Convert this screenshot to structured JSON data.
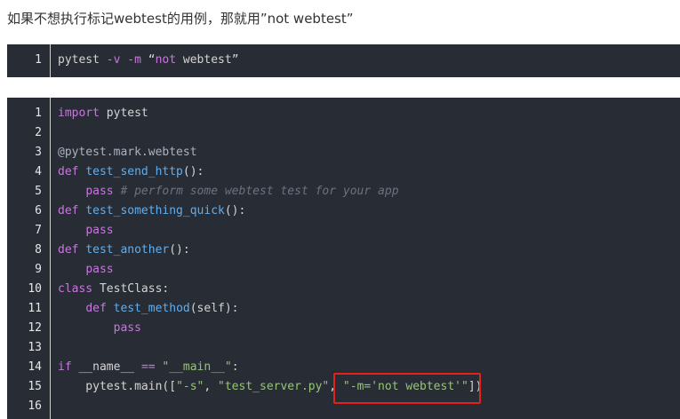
{
  "intro": "如果不想执行标记webtest的用例，那就用”not webtest”",
  "block1": {
    "lines": [
      {
        "n": "1",
        "tokens": [
          {
            "t": "pytest ",
            "c": "plain"
          },
          {
            "t": "-v",
            "c": "op"
          },
          {
            "t": " ",
            "c": "plain"
          },
          {
            "t": "-m",
            "c": "op"
          },
          {
            "t": " “",
            "c": "plain"
          },
          {
            "t": "not",
            "c": "kw"
          },
          {
            "t": " webtest”",
            "c": "plain"
          }
        ]
      }
    ]
  },
  "block2": {
    "lines": [
      {
        "n": "1",
        "tokens": [
          {
            "t": "import",
            "c": "kw"
          },
          {
            "t": " pytest",
            "c": "plain"
          }
        ]
      },
      {
        "n": "2",
        "tokens": []
      },
      {
        "n": "3",
        "tokens": [
          {
            "t": "@pytest.mark.webtest",
            "c": "dec"
          }
        ]
      },
      {
        "n": "4",
        "tokens": [
          {
            "t": "def",
            "c": "kw"
          },
          {
            "t": " ",
            "c": "plain"
          },
          {
            "t": "test_send_http",
            "c": "fn"
          },
          {
            "t": "():",
            "c": "plain"
          }
        ]
      },
      {
        "n": "5",
        "tokens": [
          {
            "t": "    ",
            "c": "plain"
          },
          {
            "t": "pass",
            "c": "kw"
          },
          {
            "t": " ",
            "c": "plain"
          },
          {
            "t": "# perform some webtest test for your app",
            "c": "cmt"
          }
        ]
      },
      {
        "n": "6",
        "tokens": [
          {
            "t": "def",
            "c": "kw"
          },
          {
            "t": " ",
            "c": "plain"
          },
          {
            "t": "test_something_quick",
            "c": "fn"
          },
          {
            "t": "():",
            "c": "plain"
          }
        ]
      },
      {
        "n": "7",
        "tokens": [
          {
            "t": "    ",
            "c": "plain"
          },
          {
            "t": "pass",
            "c": "kw"
          }
        ]
      },
      {
        "n": "8",
        "tokens": [
          {
            "t": "def",
            "c": "kw"
          },
          {
            "t": " ",
            "c": "plain"
          },
          {
            "t": "test_another",
            "c": "fn"
          },
          {
            "t": "():",
            "c": "plain"
          }
        ]
      },
      {
        "n": "9",
        "tokens": [
          {
            "t": "    ",
            "c": "plain"
          },
          {
            "t": "pass",
            "c": "kw"
          }
        ]
      },
      {
        "n": "10",
        "tokens": [
          {
            "t": "class",
            "c": "kw"
          },
          {
            "t": " TestClass:",
            "c": "plain"
          }
        ]
      },
      {
        "n": "11",
        "tokens": [
          {
            "t": "    ",
            "c": "plain"
          },
          {
            "t": "def",
            "c": "kw"
          },
          {
            "t": " ",
            "c": "plain"
          },
          {
            "t": "test_method",
            "c": "fn"
          },
          {
            "t": "(self):",
            "c": "plain"
          }
        ]
      },
      {
        "n": "12",
        "tokens": [
          {
            "t": "        ",
            "c": "plain"
          },
          {
            "t": "pass",
            "c": "kw"
          }
        ]
      },
      {
        "n": "13",
        "tokens": []
      },
      {
        "n": "14",
        "tokens": [
          {
            "t": "if",
            "c": "kw"
          },
          {
            "t": " __name__ ",
            "c": "plain"
          },
          {
            "t": "==",
            "c": "op"
          },
          {
            "t": " ",
            "c": "plain"
          },
          {
            "t": "\"__main__\"",
            "c": "str"
          },
          {
            "t": ":",
            "c": "plain"
          }
        ]
      },
      {
        "n": "15",
        "tokens": [
          {
            "t": "    pytest.main([",
            "c": "plain"
          },
          {
            "t": "\"-s\"",
            "c": "str"
          },
          {
            "t": ", ",
            "c": "plain"
          },
          {
            "t": "\"test_server.py\"",
            "c": "str"
          },
          {
            "t": ", ",
            "c": "plain"
          },
          {
            "t": "\"-m='not webtest'\"",
            "c": "str"
          },
          {
            "t": "])",
            "c": "plain"
          }
        ]
      },
      {
        "n": "16",
        "tokens": []
      }
    ]
  },
  "colors": {
    "background": "#282c34",
    "keyword": "#c678dd",
    "function": "#61aeee",
    "string": "#98c379",
    "comment": "#6d7280",
    "highlight": "#e8201c"
  }
}
